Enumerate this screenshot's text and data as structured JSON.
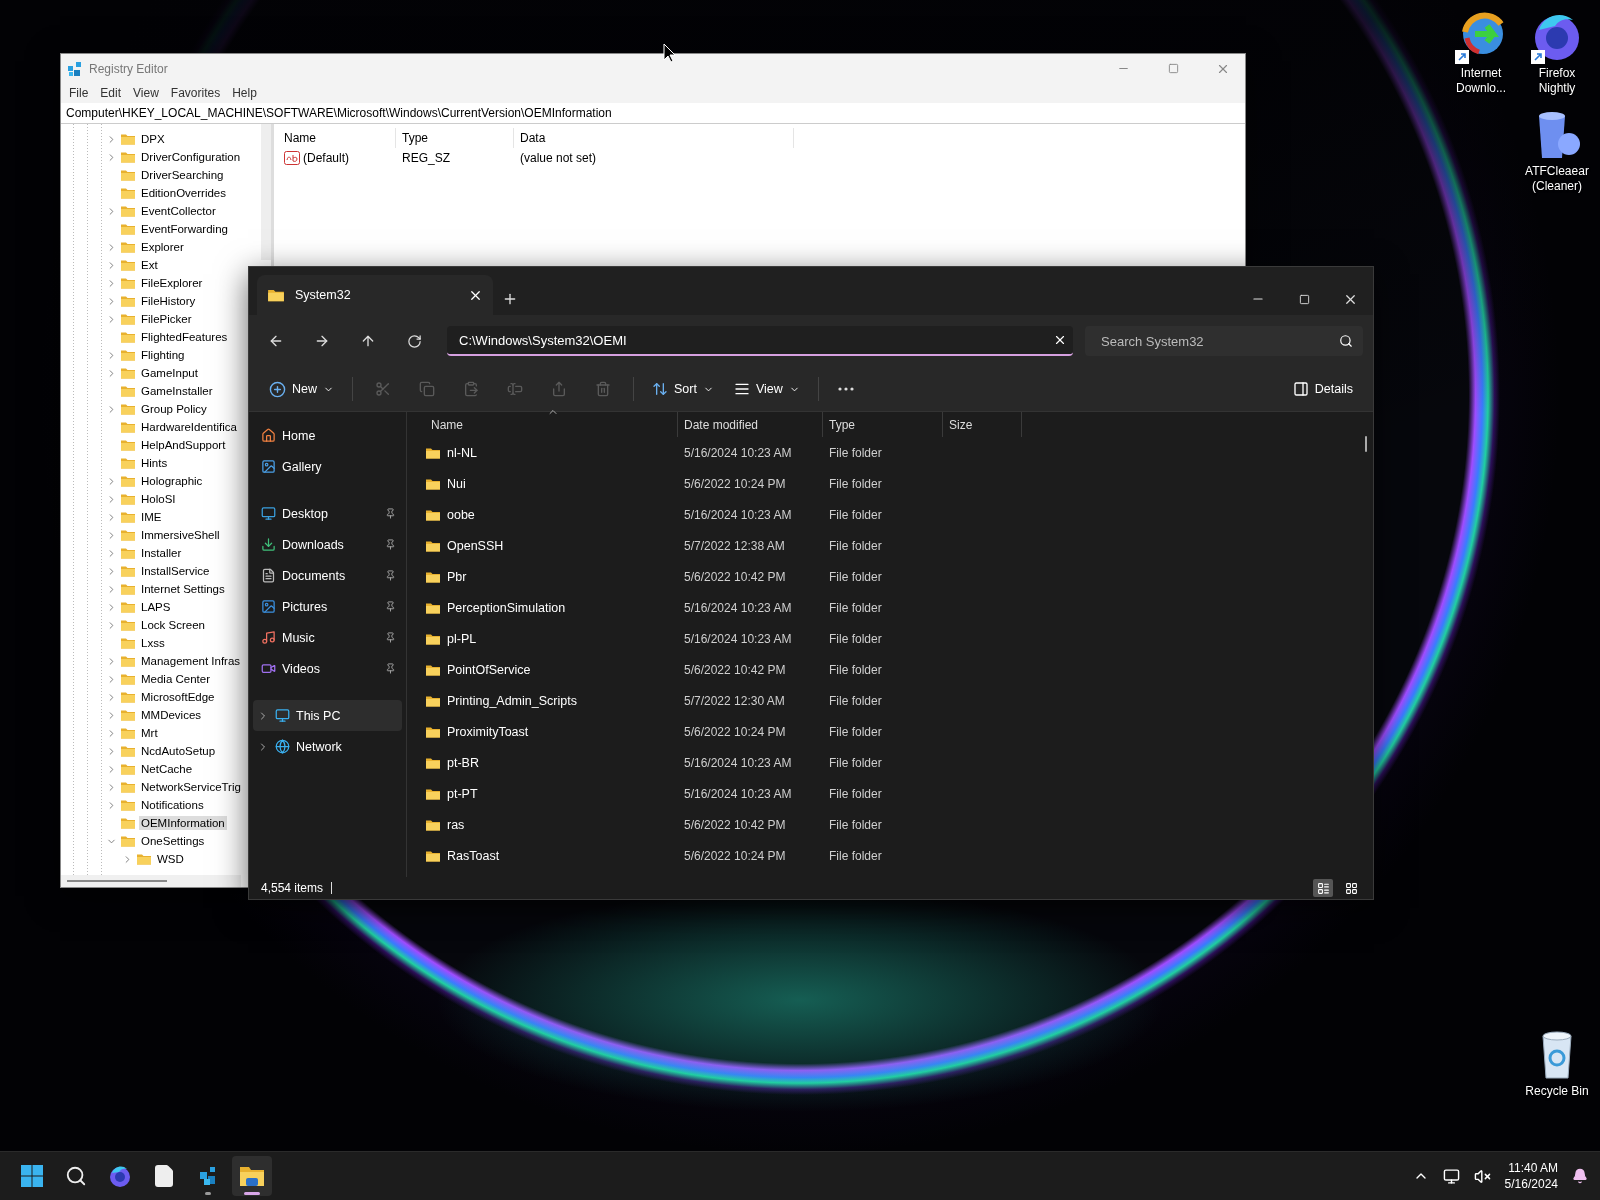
{
  "registry_editor": {
    "title": "Registry Editor",
    "menu": [
      "File",
      "Edit",
      "View",
      "Favorites",
      "Help"
    ],
    "address": "Computer\\HKEY_LOCAL_MACHINE\\SOFTWARE\\Microsoft\\Windows\\CurrentVersion\\OEMInformation",
    "tree": [
      {
        "label": "DPX",
        "expandable": true,
        "expanded": false,
        "selected": false
      },
      {
        "label": "DriverConfiguration",
        "expandable": true,
        "expanded": false,
        "selected": false
      },
      {
        "label": "DriverSearching",
        "expandable": false,
        "expanded": false,
        "selected": false
      },
      {
        "label": "EditionOverrides",
        "expandable": false,
        "expanded": false,
        "selected": false
      },
      {
        "label": "EventCollector",
        "expandable": true,
        "expanded": false,
        "selected": false
      },
      {
        "label": "EventForwarding",
        "expandable": false,
        "expanded": false,
        "selected": false
      },
      {
        "label": "Explorer",
        "expandable": true,
        "expanded": false,
        "selected": false
      },
      {
        "label": "Ext",
        "expandable": true,
        "expanded": false,
        "selected": false
      },
      {
        "label": "FileExplorer",
        "expandable": true,
        "expanded": false,
        "selected": false
      },
      {
        "label": "FileHistory",
        "expandable": true,
        "expanded": false,
        "selected": false
      },
      {
        "label": "FilePicker",
        "expandable": true,
        "expanded": false,
        "selected": false
      },
      {
        "label": "FlightedFeatures",
        "expandable": false,
        "expanded": false,
        "selected": false
      },
      {
        "label": "Flighting",
        "expandable": true,
        "expanded": false,
        "selected": false
      },
      {
        "label": "GameInput",
        "expandable": true,
        "expanded": false,
        "selected": false
      },
      {
        "label": "GameInstaller",
        "expandable": false,
        "expanded": false,
        "selected": false
      },
      {
        "label": "Group Policy",
        "expandable": true,
        "expanded": false,
        "selected": false
      },
      {
        "label": "HardwareIdentifica",
        "expandable": false,
        "expanded": false,
        "selected": false
      },
      {
        "label": "HelpAndSupport",
        "expandable": false,
        "expanded": false,
        "selected": false
      },
      {
        "label": "Hints",
        "expandable": false,
        "expanded": false,
        "selected": false
      },
      {
        "label": "Holographic",
        "expandable": true,
        "expanded": false,
        "selected": false
      },
      {
        "label": "HoloSI",
        "expandable": true,
        "expanded": false,
        "selected": false
      },
      {
        "label": "IME",
        "expandable": true,
        "expanded": false,
        "selected": false
      },
      {
        "label": "ImmersiveShell",
        "expandable": true,
        "expanded": false,
        "selected": false
      },
      {
        "label": "Installer",
        "expandable": true,
        "expanded": false,
        "selected": false
      },
      {
        "label": "InstallService",
        "expandable": true,
        "expanded": false,
        "selected": false
      },
      {
        "label": "Internet Settings",
        "expandable": true,
        "expanded": false,
        "selected": false
      },
      {
        "label": "LAPS",
        "expandable": true,
        "expanded": false,
        "selected": false
      },
      {
        "label": "Lock Screen",
        "expandable": true,
        "expanded": false,
        "selected": false
      },
      {
        "label": "Lxss",
        "expandable": false,
        "expanded": false,
        "selected": false
      },
      {
        "label": "Management Infras",
        "expandable": true,
        "expanded": false,
        "selected": false
      },
      {
        "label": "Media Center",
        "expandable": true,
        "expanded": false,
        "selected": false
      },
      {
        "label": "MicrosoftEdge",
        "expandable": true,
        "expanded": false,
        "selected": false
      },
      {
        "label": "MMDevices",
        "expandable": true,
        "expanded": false,
        "selected": false
      },
      {
        "label": "Mrt",
        "expandable": true,
        "expanded": false,
        "selected": false
      },
      {
        "label": "NcdAutoSetup",
        "expandable": true,
        "expanded": false,
        "selected": false
      },
      {
        "label": "NetCache",
        "expandable": true,
        "expanded": false,
        "selected": false
      },
      {
        "label": "NetworkServiceTrig",
        "expandable": true,
        "expanded": false,
        "selected": false
      },
      {
        "label": "Notifications",
        "expandable": true,
        "expanded": false,
        "selected": false
      },
      {
        "label": "OEMInformation",
        "expandable": false,
        "expanded": false,
        "selected": true
      },
      {
        "label": "OneSettings",
        "expandable": true,
        "expanded": true,
        "selected": false,
        "children": [
          {
            "label": "WSD",
            "expandable": true,
            "expanded": false,
            "selected": false
          }
        ]
      }
    ],
    "values": {
      "columns": [
        "Name",
        "Type",
        "Data"
      ],
      "rows": [
        {
          "name": "(Default)",
          "type": "REG_SZ",
          "data": "(value not set)"
        }
      ]
    }
  },
  "file_explorer": {
    "tab": {
      "title": "System32"
    },
    "address": "C:\\Windows\\System32\\OEMI",
    "search": {
      "placeholder": "Search System32"
    },
    "toolbar": {
      "new": "New",
      "actions": [
        {
          "disabled": true
        },
        {
          "disabled": true
        },
        {
          "disabled": true
        },
        {
          "disabled": true
        },
        {
          "disabled": true
        },
        {
          "disabled": true
        }
      ],
      "sort": "Sort",
      "view": "View",
      "details": "Details"
    },
    "sidebar": [
      {
        "label": "Home",
        "pinned": false,
        "expandable": false,
        "selected": false
      },
      {
        "label": "Gallery",
        "pinned": false,
        "expandable": false,
        "selected": false
      },
      {
        "label": "Desktop",
        "pinned": true,
        "expandable": false,
        "selected": false
      },
      {
        "label": "Downloads",
        "pinned": true,
        "expandable": false,
        "selected": false
      },
      {
        "label": "Documents",
        "pinned": true,
        "expandable": false,
        "selected": false
      },
      {
        "label": "Pictures",
        "pinned": true,
        "expandable": false,
        "selected": false
      },
      {
        "label": "Music",
        "pinned": true,
        "expandable": false,
        "selected": false
      },
      {
        "label": "Videos",
        "pinned": true,
        "expandable": false,
        "selected": false
      },
      {
        "label": "This PC",
        "pinned": false,
        "expandable": true,
        "selected": true
      },
      {
        "label": "Network",
        "pinned": false,
        "expandable": true,
        "selected": false
      }
    ],
    "columns": [
      "Name",
      "Date modified",
      "Type",
      "Size"
    ],
    "rows": [
      {
        "name": "nl-NL",
        "date": "5/16/2024 10:23 AM",
        "type": "File folder"
      },
      {
        "name": "Nui",
        "date": "5/6/2022 10:24 PM",
        "type": "File folder"
      },
      {
        "name": "oobe",
        "date": "5/16/2024 10:23 AM",
        "type": "File folder"
      },
      {
        "name": "OpenSSH",
        "date": "5/7/2022 12:38 AM",
        "type": "File folder"
      },
      {
        "name": "Pbr",
        "date": "5/6/2022 10:42 PM",
        "type": "File folder"
      },
      {
        "name": "PerceptionSimulation",
        "date": "5/16/2024 10:23 AM",
        "type": "File folder"
      },
      {
        "name": "pl-PL",
        "date": "5/16/2024 10:23 AM",
        "type": "File folder"
      },
      {
        "name": "PointOfService",
        "date": "5/6/2022 10:42 PM",
        "type": "File folder"
      },
      {
        "name": "Printing_Admin_Scripts",
        "date": "5/7/2022 12:30 AM",
        "type": "File folder"
      },
      {
        "name": "ProximityToast",
        "date": "5/6/2022 10:24 PM",
        "type": "File folder"
      },
      {
        "name": "pt-BR",
        "date": "5/16/2024 10:23 AM",
        "type": "File folder"
      },
      {
        "name": "pt-PT",
        "date": "5/16/2024 10:23 AM",
        "type": "File folder"
      },
      {
        "name": "ras",
        "date": "5/6/2022 10:42 PM",
        "type": "File folder"
      },
      {
        "name": "RasToast",
        "date": "5/6/2022 10:24 PM",
        "type": "File folder"
      }
    ],
    "status": "4,554 items",
    "view_modes": [
      {
        "selected": true
      },
      {
        "selected": false
      }
    ]
  },
  "desktop_icons": [
    {
      "label": "Internet Downlo...",
      "shortcut": true
    },
    {
      "label": "Firefox Nightly",
      "shortcut": true
    },
    {
      "label": "ATFCleaear (Cleaner)",
      "shortcut": false
    },
    {
      "label": "Recycle Bin",
      "shortcut": false
    }
  ],
  "taskbar": {
    "apps": [
      {
        "running": false,
        "selected": false
      },
      {
        "running": false,
        "selected": false
      },
      {
        "running": true,
        "selected": false
      },
      {
        "running": true,
        "selected": true
      }
    ],
    "clock": {
      "time": "11:40 AM",
      "date": "5/16/2024"
    }
  }
}
